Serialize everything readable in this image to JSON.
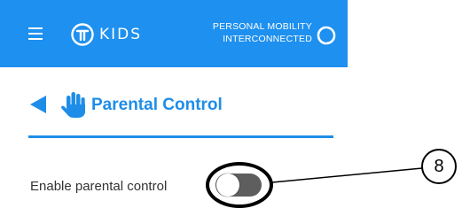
{
  "header": {
    "logo_text": "KIDS",
    "tagline_line1": "PERSONAL MOBILITY",
    "tagline_line2": "INTERCONNECTED",
    "background_color": "#1e90ef",
    "menu_icon": "hamburger-menu-icon",
    "connect_icon": "interconnected-ring-icon"
  },
  "page": {
    "title": "Parental Control",
    "back_icon": "back-arrow-icon",
    "title_icon": "hand-icon",
    "accent_color": "#1e8de8"
  },
  "settings": [
    {
      "label": "Enable parental control",
      "enabled": false
    }
  ],
  "callout": {
    "number": "8"
  }
}
